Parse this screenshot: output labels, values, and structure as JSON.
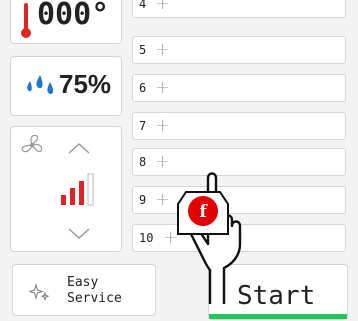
{
  "temperature": {
    "value": "000°",
    "icon": "thermometer-icon"
  },
  "humidity": {
    "value": "75%",
    "icon": "water-drops-icon",
    "color": "#1f77c9"
  },
  "fan": {
    "icon": "fan-icon",
    "level_bars": 3,
    "level_max": 4,
    "active_color": "#e02424"
  },
  "levels": [
    {
      "num": "4"
    },
    {
      "num": "5"
    },
    {
      "num": "6"
    },
    {
      "num": "7"
    },
    {
      "num": "8"
    },
    {
      "num": "9"
    },
    {
      "num": "10"
    }
  ],
  "easy_service": {
    "label_line1": "Easy",
    "label_line2": "Service",
    "icon": "sparkle-icon"
  },
  "start": {
    "label": "Start",
    "accent": "#22c55e"
  },
  "cursor": {
    "badge": "f",
    "icon": "pointing-hand-icon",
    "badge_color": "#e00000"
  }
}
